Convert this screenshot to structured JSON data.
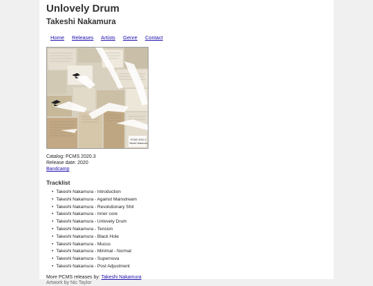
{
  "album_title": "Unlovely Drum",
  "artist": "Takeshi Nakamura",
  "nav": [
    {
      "label": "Home"
    },
    {
      "label": "Releases"
    },
    {
      "label": "Artists"
    },
    {
      "label": "Genre"
    },
    {
      "label": "Contact"
    }
  ],
  "cover": {
    "label_line1": "PCMS 2020.3",
    "label_line2": "Takeshi Nakamura"
  },
  "catalog": "Catalog: PCMS 2020.3",
  "release_date": "Release date: 2020",
  "bandcamp_link": "Bandcamp",
  "tracklist_heading": "Tracklist",
  "tracks": [
    "Takeshi Nakamura - Introduction",
    "Takeshi Nakamura - Against Mainstream",
    "Takeshi Nakamura - Revolutionary Shit",
    "Takeshi Nakamura - Inner core",
    "Takeshi Nakamura - Unlovely Drum",
    "Takeshi Nakamura - Tension",
    "Takeshi Nakamura - Black Hole",
    "Takeshi Nakamura - Mucus",
    "Takeshi Nakamura - Minimal - Normal",
    "Takeshi Nakamura - Supernova",
    "Takeshi Nakamura - Post Adjustment"
  ],
  "more_releases_text": "More PCMS releases by: ",
  "more_releases_link": "Takeshi Nakamura",
  "artwork_text": "Artwork by Nic Taylor"
}
